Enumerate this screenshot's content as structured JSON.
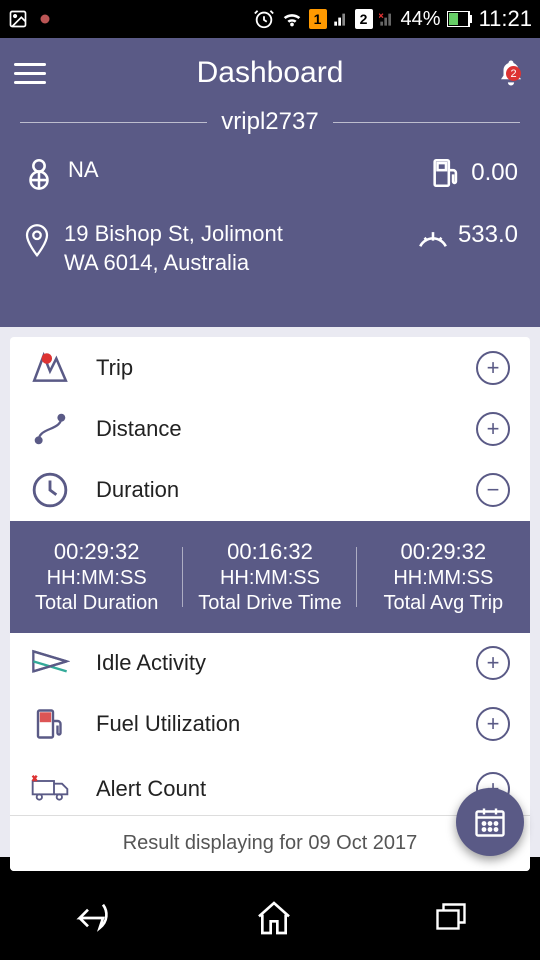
{
  "status_bar": {
    "sim1": "1",
    "sim2": "2",
    "battery": "44%",
    "time": "11:21"
  },
  "header": {
    "title": "Dashboard",
    "notification_count": "2",
    "vehicle_id": "vripl2737"
  },
  "info": {
    "driver": "NA",
    "fuel": "0.00",
    "address_line1": "19 Bishop St, Jolimont",
    "address_line2": "WA 6014, Australia",
    "odometer": "533.0"
  },
  "list": {
    "trip": "Trip",
    "distance": "Distance",
    "duration": "Duration",
    "idle": "Idle Activity",
    "fuel": "Fuel Utilization",
    "alert": "Alert Count"
  },
  "duration_panel": {
    "format": "HH:MM:SS",
    "cols": [
      {
        "time": "00:29:32",
        "label": "Total Duration"
      },
      {
        "time": "00:16:32",
        "label": "Total Drive Time"
      },
      {
        "time": "00:29:32",
        "label": "Total Avg Trip"
      }
    ]
  },
  "footer": {
    "result_text": "Result displaying for 09 Oct 2017"
  }
}
